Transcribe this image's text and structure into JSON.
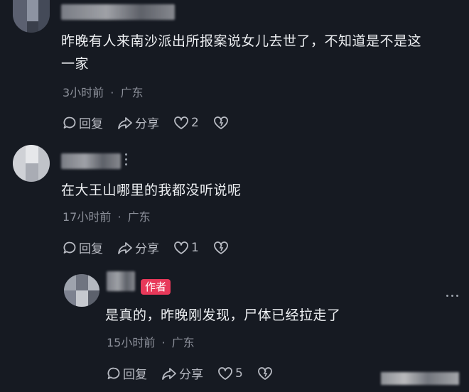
{
  "comments": [
    {
      "text_line1": "昨晚有人来南沙派出所报案说女儿去世了，不知道是不是这",
      "text_line2": "一家",
      "time": "3小时前",
      "location": "广东",
      "reply_label": "回复",
      "share_label": "分享",
      "like_count": "2"
    },
    {
      "text": "在大王山哪里的我都没听说呢",
      "time": "17小时前",
      "location": "广东",
      "reply_label": "回复",
      "share_label": "分享",
      "like_count": "1"
    },
    {
      "author_badge": "作者",
      "text": "是真的，昨晚刚发现，尸体已经拉走了",
      "time": "15小时前",
      "location": "广东",
      "reply_label": "回复",
      "share_label": "分享",
      "like_count": "5"
    }
  ],
  "meta_separator": "·",
  "icons": [
    "reply-icon",
    "share-icon",
    "like-icon",
    "dislike-icon",
    "more-icon"
  ],
  "colors": {
    "background": "#161a22",
    "badge": "#e8395a",
    "meta": "#8c909a"
  }
}
